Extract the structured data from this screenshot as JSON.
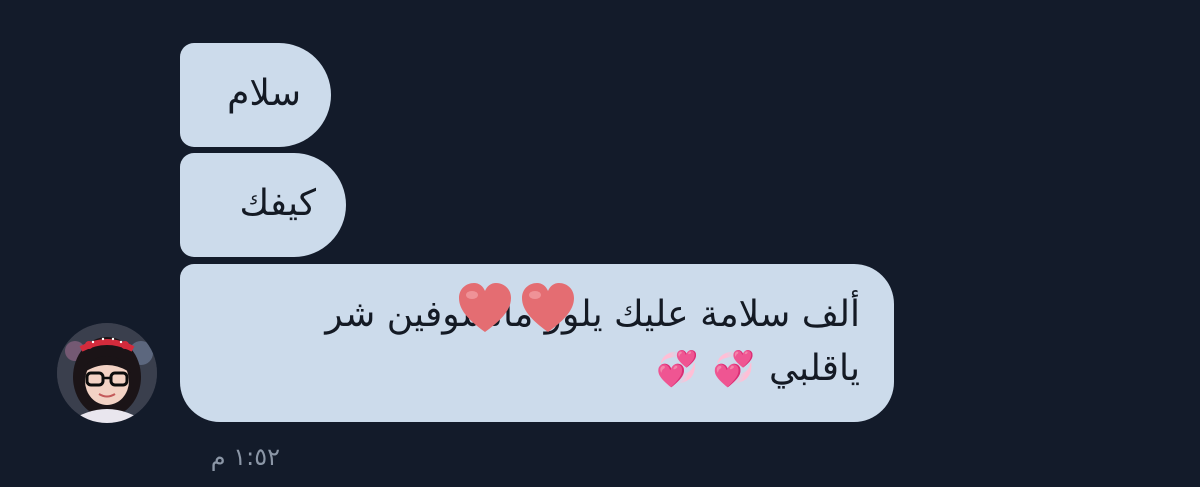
{
  "colors": {
    "background": "#131b2a",
    "bubble": "#ccdbeb",
    "text": "#141a24",
    "timestamp": "#8b96a6",
    "heart": "#e46d72"
  },
  "messages": [
    {
      "text": "سلام"
    },
    {
      "text": "كيفك"
    },
    {
      "line1": "ألف سلامة عليك يلوو ماتشوفين شر",
      "line2": "ياقلبي",
      "emoji": [
        "💞",
        "💞"
      ]
    }
  ],
  "overlay_icons": [
    "heart-icon",
    "heart-icon"
  ],
  "avatar_icon": "avatar-girl-glasses",
  "timestamp": "١:٥٢ م"
}
